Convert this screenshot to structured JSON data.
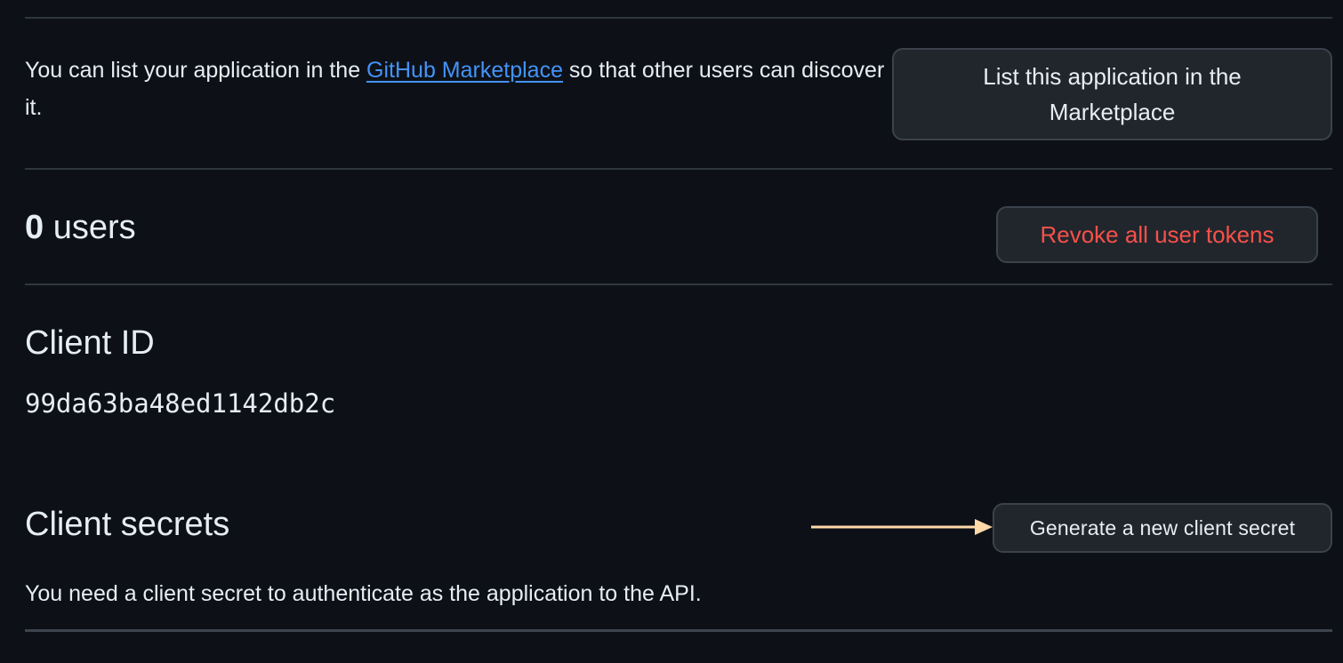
{
  "marketplace": {
    "text_before": "You can list your application in the ",
    "link_text": "GitHub Marketplace",
    "text_after": " so that other users can discover it.",
    "button_label": "List this application in the Marketplace"
  },
  "users": {
    "count": "0",
    "label": " users",
    "revoke_label": "Revoke all user tokens"
  },
  "client_id": {
    "title": "Client ID",
    "value": "99da63ba48ed1142db2c"
  },
  "client_secrets": {
    "title": "Client secrets",
    "generate_label": "Generate a new client secret",
    "description": "You need a client secret to authenticate as the application to the API."
  },
  "colors": {
    "background": "#0d1117",
    "link": "#4493f8",
    "danger": "#f85149",
    "annotation_arrow": "#ffd9a8"
  }
}
